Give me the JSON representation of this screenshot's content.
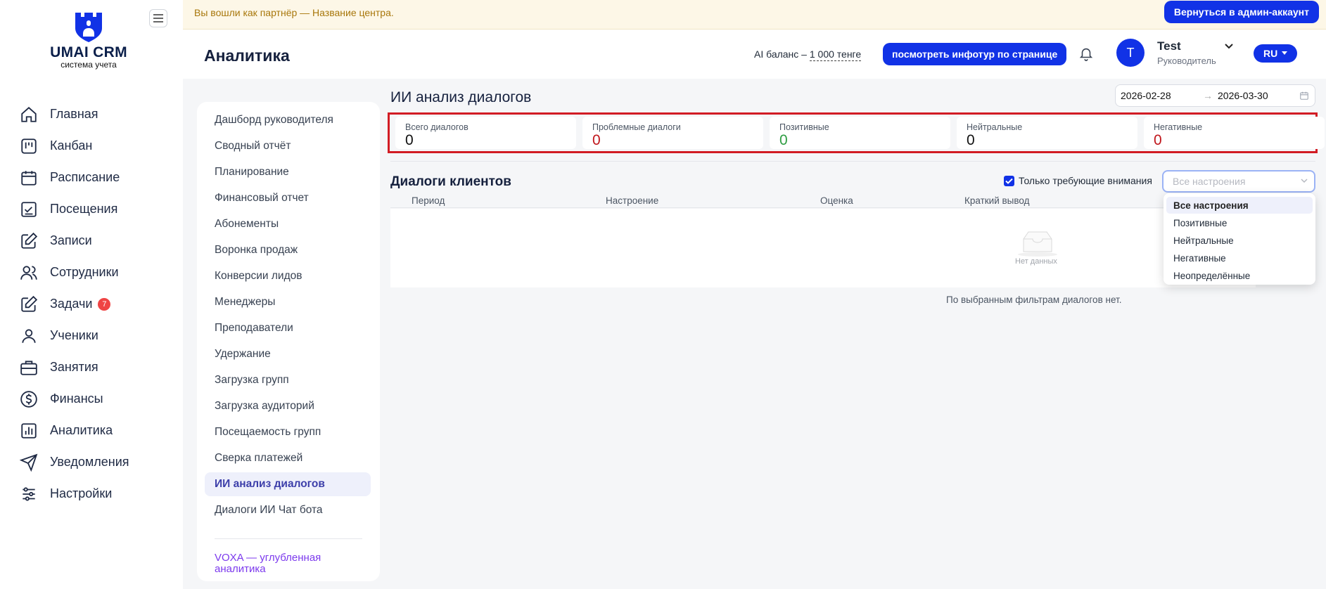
{
  "brand": {
    "name": "UMAI CRM",
    "tagline": "система учета"
  },
  "banner": {
    "text": "Вы вошли как партнёр — Название центра.",
    "button": "Вернуться в админ-аккаунт"
  },
  "header": {
    "title": "Аналитика",
    "ai_label": "AI баланс –",
    "ai_value": "1 000 тенге",
    "tour_button": "посмотреть инфотур по странице",
    "user_initial": "T",
    "user_name": "Test",
    "user_role": "Руководитель",
    "lang": "RU"
  },
  "nav": [
    {
      "label": "Главная",
      "icon": "home-icon"
    },
    {
      "label": "Канбан",
      "icon": "kanban-icon"
    },
    {
      "label": "Расписание",
      "icon": "calendar-icon"
    },
    {
      "label": "Посещения",
      "icon": "attendance-icon"
    },
    {
      "label": "Записи",
      "icon": "edit-icon"
    },
    {
      "label": "Сотрудники",
      "icon": "users-icon"
    },
    {
      "label": "Задачи",
      "icon": "tasks-icon",
      "badge": "7"
    },
    {
      "label": "Ученики",
      "icon": "user-icon"
    },
    {
      "label": "Занятия",
      "icon": "briefcase-icon"
    },
    {
      "label": "Финансы",
      "icon": "dollar-icon"
    },
    {
      "label": "Аналитика",
      "icon": "chart-icon"
    },
    {
      "label": "Уведомления",
      "icon": "send-icon"
    },
    {
      "label": "Настройки",
      "icon": "sliders-icon"
    }
  ],
  "subnav": {
    "items": [
      "Дашборд руководителя",
      "Сводный отчёт",
      "Планирование",
      "Финансовый отчет",
      "Абонементы",
      "Воронка продаж",
      "Конверсии лидов",
      "Менеджеры",
      "Преподаватели",
      "Удержание",
      "Загрузка групп",
      "Загрузка аудиторий",
      "Посещаемость групп",
      "Сверка платежей",
      "ИИ анализ диалогов",
      "Диалоги ИИ Чат бота"
    ],
    "active": "ИИ анализ диалогов",
    "voxa": "VOXA — углубленная аналитика"
  },
  "main": {
    "title": "ИИ анализ диалогов",
    "date_from": "2026-02-28",
    "date_to": "2026-03-30",
    "stats": [
      {
        "label": "Всего диалогов",
        "value": "0",
        "color": "#111111"
      },
      {
        "label": "Проблемные диалоги",
        "value": "0",
        "color": "#c0161c"
      },
      {
        "label": "Позитивные",
        "value": "0",
        "color": "#2e9d42"
      },
      {
        "label": "Нейтральные",
        "value": "0",
        "color": "#111111"
      },
      {
        "label": "Негативные",
        "value": "0",
        "color": "#c0161c"
      }
    ],
    "section_title": "Диалоги клиентов",
    "checkbox_label": "Только требующие внимания",
    "select_placeholder": "Все настроения",
    "columns": [
      "Период",
      "Настроение",
      "Оценка",
      "Краткий вывод"
    ],
    "empty": "Нет данных",
    "no_filter": "По выбранным фильтрам диалогов нет.",
    "dropdown": [
      "Все настроения",
      "Позитивные",
      "Нейтральные",
      "Негативные",
      "Неопределённые"
    ]
  }
}
